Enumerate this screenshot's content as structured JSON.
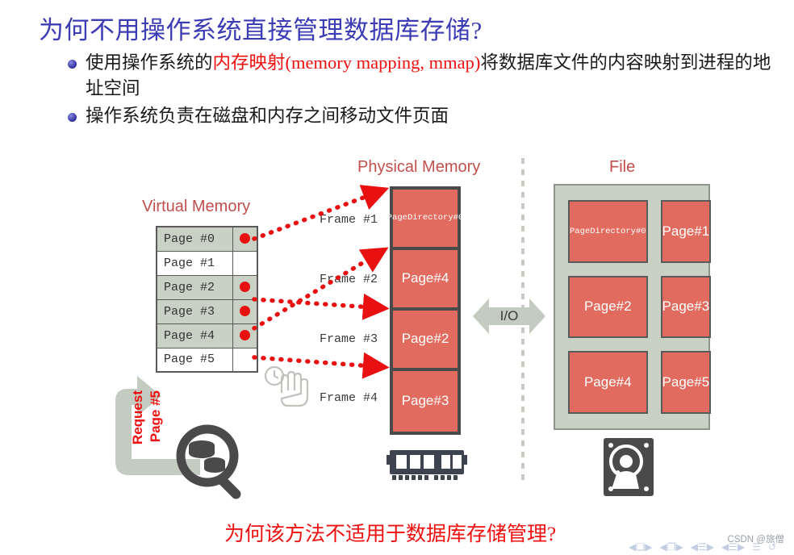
{
  "title": "为何不用操作系统直接管理数据库存储?",
  "bullets": [
    {
      "pre": "使用操作系统的",
      "highlight": "内存映射(memory mapping, mmap)",
      "post": "将数据库文件的内容映射到进程的地址空间"
    },
    {
      "pre": "操作系统负责在磁盘和内存之间移动文件页面",
      "highlight": "",
      "post": ""
    }
  ],
  "diagram": {
    "virtual_memory": {
      "heading": "Virtual Memory",
      "rows": [
        {
          "label": "Page  #0",
          "mapped": true
        },
        {
          "label": "Page  #1",
          "mapped": false
        },
        {
          "label": "Page  #2",
          "mapped": true
        },
        {
          "label": "Page  #3",
          "mapped": true
        },
        {
          "label": "Page  #4",
          "mapped": true
        },
        {
          "label": "Page  #5",
          "mapped": false
        }
      ]
    },
    "physical_memory": {
      "heading": "Physical Memory",
      "frame_labels": [
        "Frame  #1",
        "Frame  #2",
        "Frame  #3",
        "Frame  #4"
      ],
      "cells": [
        {
          "text": "Page\nDirectory\n#0",
          "style": "small"
        },
        {
          "text": "Page\n#4",
          "style": "big"
        },
        {
          "text": "Page\n#2",
          "style": "big"
        },
        {
          "text": "Page\n#3",
          "style": "big"
        }
      ]
    },
    "file": {
      "heading": "File",
      "cells": [
        {
          "text": "Page\nDirectory\n#0",
          "style": "small"
        },
        {
          "text": "Page\n#1",
          "style": "big"
        },
        {
          "text": "Page\n#2",
          "style": "big"
        },
        {
          "text": "Page\n#3",
          "style": "big"
        },
        {
          "text": "Page\n#4",
          "style": "big"
        },
        {
          "text": "Page\n#5",
          "style": "big"
        }
      ]
    },
    "io_label": "I/O",
    "request_label_line1": "Request",
    "request_label_line2": "Page #5"
  },
  "caption": "为何该方法不适用于数据库存储管理?",
  "watermark": "CSDN @旅僧",
  "colors": {
    "title": "#3c3cb4",
    "highlight_red": "#ef1010",
    "section_heading": "#c0504d",
    "page_fill": "#e06b5e",
    "panel_gray": "#c9d1c4",
    "icon_dark": "#3d4450"
  }
}
